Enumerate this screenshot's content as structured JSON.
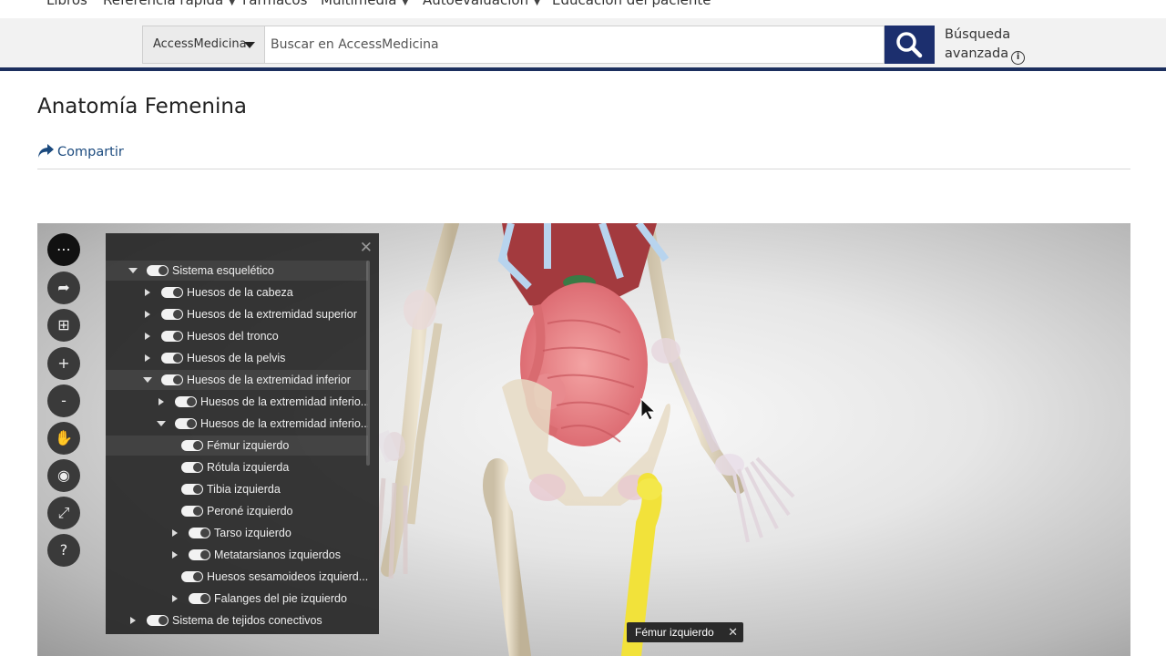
{
  "nav": {
    "items": [
      {
        "label": "Libros",
        "has_caret": false
      },
      {
        "label": "Referencia rápida",
        "has_caret": true
      },
      {
        "label": "Fármacos",
        "has_caret": false
      },
      {
        "label": "Multimedia",
        "has_caret": true
      },
      {
        "label": "Autoevaluación",
        "has_caret": true
      },
      {
        "label": "Educación del paciente",
        "has_caret": false
      }
    ]
  },
  "search": {
    "scope": "AccessMedicina",
    "placeholder": "Buscar en AccessMedicina",
    "advanced_line1": "Búsqueda",
    "advanced_line2": "avanzada"
  },
  "page": {
    "title": "Anatomía Femenina",
    "share_label": "Compartir"
  },
  "viewer": {
    "tools": [
      {
        "icon": "more-icon",
        "glyph": "⋯"
      },
      {
        "icon": "share-icon",
        "glyph": "➦"
      },
      {
        "icon": "hierarchy-icon",
        "glyph": "⊞"
      },
      {
        "icon": "zoom-in-icon",
        "glyph": "+"
      },
      {
        "icon": "zoom-out-icon",
        "glyph": "-"
      },
      {
        "icon": "pan-hand-icon",
        "glyph": "✋"
      },
      {
        "icon": "center-target-icon",
        "glyph": "◉"
      },
      {
        "icon": "fullscreen-icon",
        "glyph": "⤢"
      },
      {
        "icon": "help-icon",
        "glyph": "?"
      }
    ],
    "tree": [
      {
        "label": "Sistema esquelético",
        "level": 0,
        "arrow": "down",
        "highlight": true
      },
      {
        "label": "Huesos de la cabeza",
        "level": 1,
        "arrow": "right"
      },
      {
        "label": "Huesos de la extremidad superior",
        "level": 1,
        "arrow": "right"
      },
      {
        "label": "Huesos del tronco",
        "level": 1,
        "arrow": "right"
      },
      {
        "label": "Huesos de la pelvis",
        "level": 1,
        "arrow": "right"
      },
      {
        "label": "Huesos de la extremidad inferior",
        "level": 1,
        "arrow": "down",
        "highlight": true
      },
      {
        "label": "Huesos de la extremidad inferio...",
        "level": 2,
        "arrow": "right"
      },
      {
        "label": "Huesos de la extremidad inferio...",
        "level": 2,
        "arrow": "down"
      },
      {
        "label": "Fémur izquierdo",
        "level": 3,
        "arrow": "none",
        "highlight": true
      },
      {
        "label": "Rótula izquierda",
        "level": 3,
        "arrow": "none"
      },
      {
        "label": "Tibia izquierda",
        "level": 3,
        "arrow": "none"
      },
      {
        "label": "Peroné izquierdo",
        "level": 3,
        "arrow": "none"
      },
      {
        "label": "Tarso izquierdo",
        "level": 3,
        "arrow": "right"
      },
      {
        "label": "Metatarsianos izquierdos",
        "level": 3,
        "arrow": "right"
      },
      {
        "label": "Huesos sesamoideos izquierd...",
        "level": 3,
        "arrow": "none"
      },
      {
        "label": "Falanges del pie izquierdo",
        "level": 3,
        "arrow": "right"
      },
      {
        "label": "Sistema de tejidos conectivos",
        "level": 0,
        "arrow": "right"
      }
    ],
    "tooltip": "Fémur izquierdo"
  },
  "colors": {
    "nav_blue": "#1c2f6e",
    "link_blue": "#1b4a7e",
    "femur_highlight": "#f2e23a"
  }
}
